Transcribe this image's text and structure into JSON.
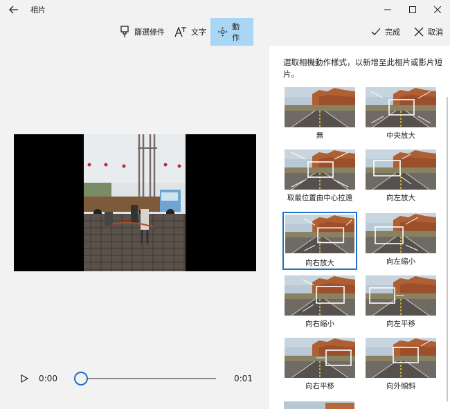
{
  "titlebar": {
    "title": "相片",
    "back_icon": "back-arrow-icon",
    "controls": [
      "minimize-icon",
      "maximize-icon",
      "close-icon"
    ]
  },
  "toolbar": {
    "filter_label": "篩選條件",
    "text_label": "文字",
    "motion_label": "動作",
    "done_label": "完成",
    "cancel_label": "取消",
    "active_color": "#a9d6f5"
  },
  "player": {
    "current_time": "0:00",
    "end_time": "0:01",
    "progress": 0
  },
  "panel": {
    "description": "選取相機動作樣式，以新增至此相片或影片短片。",
    "selected_index": 4,
    "accent_color": "#1f6fc5",
    "styles": [
      {
        "label": "無",
        "box": "none"
      },
      {
        "label": "中央放大",
        "box": "center-in"
      },
      {
        "label": "取最位置由中心拉遠",
        "box": "center-out"
      },
      {
        "label": "向左放大",
        "box": "left-in"
      },
      {
        "label": "向右放大",
        "box": "right-in"
      },
      {
        "label": "向左縮小",
        "box": "left-out"
      },
      {
        "label": "向右縮小",
        "box": "right-out"
      },
      {
        "label": "向左平移",
        "box": "pan-left"
      },
      {
        "label": "向右平移",
        "box": "pan-right"
      },
      {
        "label": "向外傾斜",
        "box": "tilt-out"
      }
    ]
  }
}
